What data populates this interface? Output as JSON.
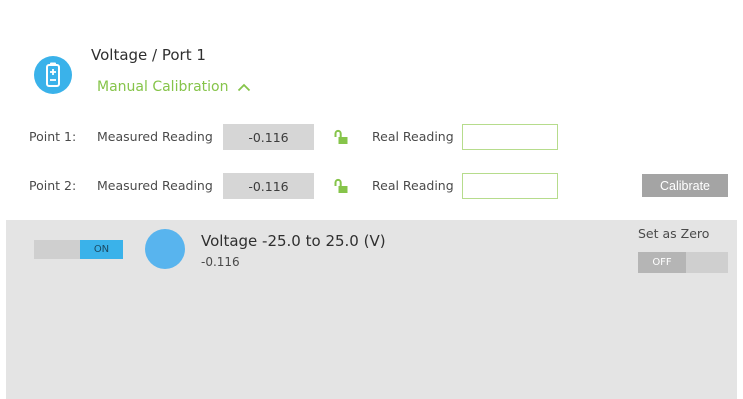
{
  "sensor": {
    "title": "Voltage / Port 1",
    "icon": "battery-icon",
    "calibration_toggle": "Manual Calibration"
  },
  "points": [
    {
      "label": "Point 1:",
      "measured_label": "Measured Reading",
      "measured_value": "-0.116",
      "lock": "unlocked",
      "real_label": "Real Reading",
      "real_value": ""
    },
    {
      "label": "Point 2:",
      "measured_label": "Measured Reading",
      "measured_value": "-0.116",
      "lock": "unlocked",
      "real_label": "Real Reading",
      "real_value": ""
    }
  ],
  "calibrate_label": "Calibrate",
  "readout": {
    "power_state": "ON",
    "title": "Voltage -25.0 to 25.0 (V)",
    "value": "-0.116",
    "zero_label": "Set as Zero",
    "zero_state": "OFF"
  },
  "colors": {
    "accent_blue": "#3ab2ea",
    "accent_green": "#86c44a",
    "panel_gray": "#e4e4e4"
  }
}
